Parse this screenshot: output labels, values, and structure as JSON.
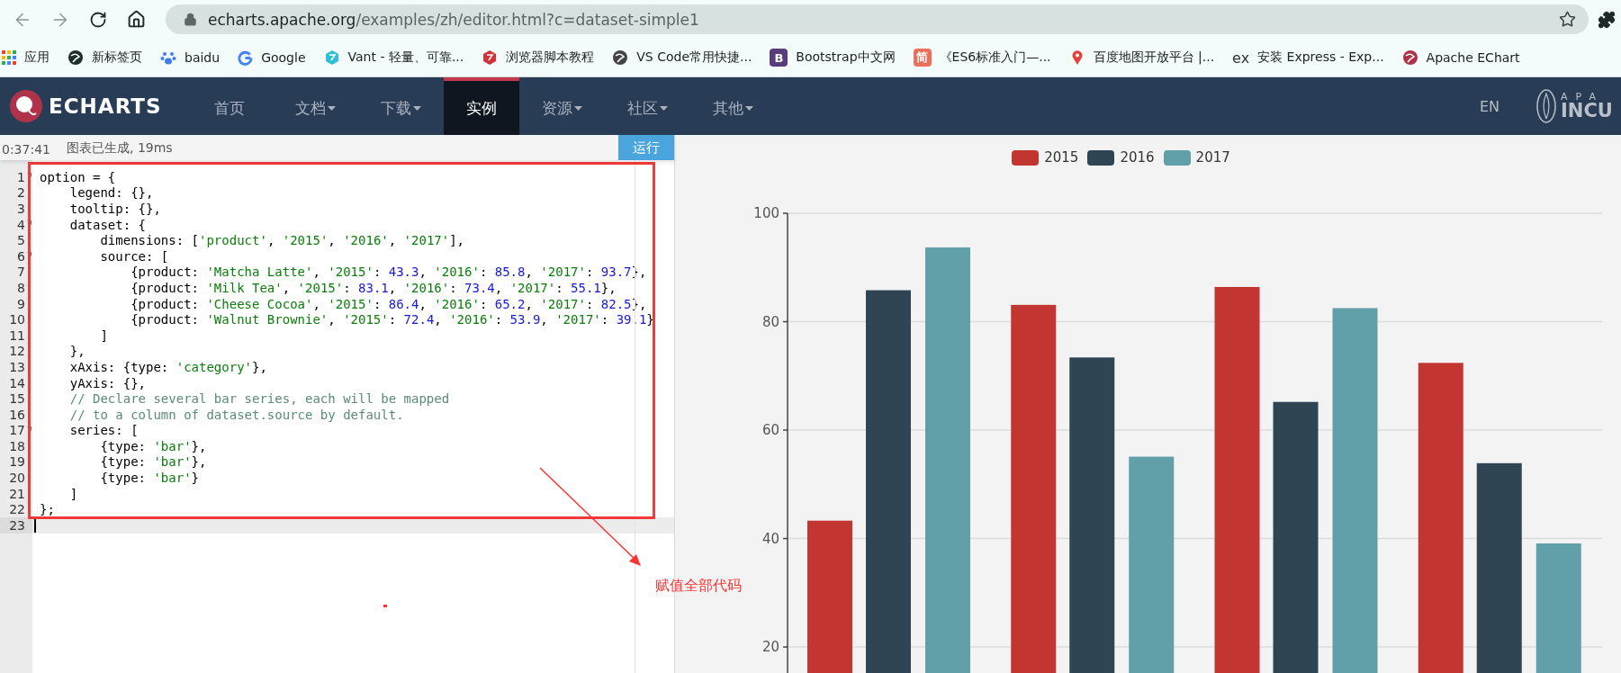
{
  "browser": {
    "address": {
      "host": "echarts.apache.org",
      "path": "/examples/zh/editor.html?c=dataset-simple1"
    },
    "bookmarks": [
      {
        "label": "应用",
        "kind": "apps"
      },
      {
        "label": "新标签页",
        "kind": "globe",
        "color": "#1f2d2d"
      },
      {
        "label": "baidu",
        "kind": "paw",
        "color": "#3b7cf0"
      },
      {
        "label": "Google",
        "kind": "google",
        "color": "#4285f4"
      },
      {
        "label": "Vant - 轻量、可靠...",
        "kind": "hex",
        "color": "#2fc0d4"
      },
      {
        "label": "浏览器脚本教程",
        "kind": "hex",
        "color": "#d4303a"
      },
      {
        "label": "VS Code常用快捷...",
        "kind": "globe",
        "color": "#444444"
      },
      {
        "label": "Bootstrap中文网",
        "kind": "glyph",
        "glyph": "B",
        "color": "#563d7c"
      },
      {
        "label": "《ES6标准入门—...",
        "kind": "glyph",
        "glyph": "简",
        "color": "#ea6f5a"
      },
      {
        "label": "百度地图开放平台 |...",
        "kind": "pin",
        "color": "#e8413b"
      },
      {
        "label": "安装 Express - Exp...",
        "kind": "text",
        "glyph": "ex",
        "color": "#333333"
      },
      {
        "label": "Apache EChart",
        "kind": "globe",
        "color": "#b0324a"
      }
    ]
  },
  "navbar": {
    "logo": "ECHARTS",
    "items": [
      {
        "label": "首页",
        "dropdown": false,
        "selected": false
      },
      {
        "label": "文档",
        "dropdown": true,
        "selected": false
      },
      {
        "label": "下载",
        "dropdown": true,
        "selected": false
      },
      {
        "label": "实例",
        "dropdown": false,
        "selected": true
      },
      {
        "label": "资源",
        "dropdown": true,
        "selected": false
      },
      {
        "label": "社区",
        "dropdown": true,
        "selected": false
      },
      {
        "label": "其他",
        "dropdown": true,
        "selected": false
      }
    ],
    "language": "EN",
    "incubator": {
      "top": "APA",
      "bottom": "INCU"
    }
  },
  "editor": {
    "time": "0:37:41",
    "status": "图表已生成, 19ms",
    "run_button": "运行",
    "lines": [
      {
        "number": "1",
        "fold": true,
        "current": false,
        "tokens": [
          {
            "kind": "plain",
            "text": "option = {"
          }
        ]
      },
      {
        "number": "2",
        "fold": false,
        "current": false,
        "tokens": [
          {
            "kind": "plain",
            "text": "    legend: {},"
          }
        ]
      },
      {
        "number": "3",
        "fold": false,
        "current": false,
        "tokens": [
          {
            "kind": "plain",
            "text": "    tooltip: {},"
          }
        ]
      },
      {
        "number": "4",
        "fold": true,
        "current": false,
        "tokens": [
          {
            "kind": "plain",
            "text": "    dataset: {"
          }
        ]
      },
      {
        "number": "5",
        "fold": false,
        "current": false,
        "tokens": [
          {
            "kind": "plain",
            "text": "        dimensions: ["
          },
          {
            "kind": "string",
            "text": "'product'"
          },
          {
            "kind": "plain",
            "text": ", "
          },
          {
            "kind": "string",
            "text": "'2015'"
          },
          {
            "kind": "plain",
            "text": ", "
          },
          {
            "kind": "string",
            "text": "'2016'"
          },
          {
            "kind": "plain",
            "text": ", "
          },
          {
            "kind": "string",
            "text": "'2017'"
          },
          {
            "kind": "plain",
            "text": "],"
          }
        ]
      },
      {
        "number": "6",
        "fold": true,
        "current": false,
        "tokens": [
          {
            "kind": "plain",
            "text": "        source: ["
          }
        ]
      },
      {
        "number": "7",
        "fold": false,
        "current": false,
        "tokens": [
          {
            "kind": "plain",
            "text": "            {product: "
          },
          {
            "kind": "string",
            "text": "'Matcha Latte'"
          },
          {
            "kind": "plain",
            "text": ", "
          },
          {
            "kind": "string",
            "text": "'2015'"
          },
          {
            "kind": "plain",
            "text": ": "
          },
          {
            "kind": "number",
            "text": "43.3"
          },
          {
            "kind": "plain",
            "text": ", "
          },
          {
            "kind": "string",
            "text": "'2016'"
          },
          {
            "kind": "plain",
            "text": ": "
          },
          {
            "kind": "number",
            "text": "85.8"
          },
          {
            "kind": "plain",
            "text": ", "
          },
          {
            "kind": "string",
            "text": "'2017'"
          },
          {
            "kind": "plain",
            "text": ": "
          },
          {
            "kind": "number",
            "text": "93.7"
          },
          {
            "kind": "plain",
            "text": "},"
          }
        ]
      },
      {
        "number": "8",
        "fold": false,
        "current": false,
        "tokens": [
          {
            "kind": "plain",
            "text": "            {product: "
          },
          {
            "kind": "string",
            "text": "'Milk Tea'"
          },
          {
            "kind": "plain",
            "text": ", "
          },
          {
            "kind": "string",
            "text": "'2015'"
          },
          {
            "kind": "plain",
            "text": ": "
          },
          {
            "kind": "number",
            "text": "83.1"
          },
          {
            "kind": "plain",
            "text": ", "
          },
          {
            "kind": "string",
            "text": "'2016'"
          },
          {
            "kind": "plain",
            "text": ": "
          },
          {
            "kind": "number",
            "text": "73.4"
          },
          {
            "kind": "plain",
            "text": ", "
          },
          {
            "kind": "string",
            "text": "'2017'"
          },
          {
            "kind": "plain",
            "text": ": "
          },
          {
            "kind": "number",
            "text": "55.1"
          },
          {
            "kind": "plain",
            "text": "},"
          }
        ]
      },
      {
        "number": "9",
        "fold": false,
        "current": false,
        "tokens": [
          {
            "kind": "plain",
            "text": "            {product: "
          },
          {
            "kind": "string",
            "text": "'Cheese Cocoa'"
          },
          {
            "kind": "plain",
            "text": ", "
          },
          {
            "kind": "string",
            "text": "'2015'"
          },
          {
            "kind": "plain",
            "text": ": "
          },
          {
            "kind": "number",
            "text": "86.4"
          },
          {
            "kind": "plain",
            "text": ", "
          },
          {
            "kind": "string",
            "text": "'2016'"
          },
          {
            "kind": "plain",
            "text": ": "
          },
          {
            "kind": "number",
            "text": "65.2"
          },
          {
            "kind": "plain",
            "text": ", "
          },
          {
            "kind": "string",
            "text": "'2017'"
          },
          {
            "kind": "plain",
            "text": ": "
          },
          {
            "kind": "number",
            "text": "82.5"
          },
          {
            "kind": "plain",
            "text": "},"
          }
        ]
      },
      {
        "number": "10",
        "fold": false,
        "current": false,
        "tokens": [
          {
            "kind": "plain",
            "text": "            {product: "
          },
          {
            "kind": "string",
            "text": "'Walnut Brownie'"
          },
          {
            "kind": "plain",
            "text": ", "
          },
          {
            "kind": "string",
            "text": "'2015'"
          },
          {
            "kind": "plain",
            "text": ": "
          },
          {
            "kind": "number",
            "text": "72.4"
          },
          {
            "kind": "plain",
            "text": ", "
          },
          {
            "kind": "string",
            "text": "'2016'"
          },
          {
            "kind": "plain",
            "text": ": "
          },
          {
            "kind": "number",
            "text": "53.9"
          },
          {
            "kind": "plain",
            "text": ", "
          },
          {
            "kind": "string",
            "text": "'2017'"
          },
          {
            "kind": "plain",
            "text": ": "
          },
          {
            "kind": "number",
            "text": "39.1"
          },
          {
            "kind": "plain",
            "text": "}"
          }
        ]
      },
      {
        "number": "11",
        "fold": false,
        "current": false,
        "tokens": [
          {
            "kind": "plain",
            "text": "        ]"
          }
        ]
      },
      {
        "number": "12",
        "fold": false,
        "current": false,
        "tokens": [
          {
            "kind": "plain",
            "text": "    },"
          }
        ]
      },
      {
        "number": "13",
        "fold": false,
        "current": false,
        "tokens": [
          {
            "kind": "plain",
            "text": "    xAxis: {type: "
          },
          {
            "kind": "string",
            "text": "'category'"
          },
          {
            "kind": "plain",
            "text": "},"
          }
        ]
      },
      {
        "number": "14",
        "fold": false,
        "current": false,
        "tokens": [
          {
            "kind": "plain",
            "text": "    yAxis: {},"
          }
        ]
      },
      {
        "number": "15",
        "fold": false,
        "current": false,
        "tokens": [
          {
            "kind": "comment",
            "text": "    // Declare several bar series, each will be mapped"
          }
        ]
      },
      {
        "number": "16",
        "fold": false,
        "current": false,
        "tokens": [
          {
            "kind": "comment",
            "text": "    // to a column of dataset.source by default."
          }
        ]
      },
      {
        "number": "17",
        "fold": true,
        "current": false,
        "tokens": [
          {
            "kind": "plain",
            "text": "    series: ["
          }
        ]
      },
      {
        "number": "18",
        "fold": false,
        "current": false,
        "tokens": [
          {
            "kind": "plain",
            "text": "        {type: "
          },
          {
            "kind": "string",
            "text": "'bar'"
          },
          {
            "kind": "plain",
            "text": "},"
          }
        ]
      },
      {
        "number": "19",
        "fold": false,
        "current": false,
        "tokens": [
          {
            "kind": "plain",
            "text": "        {type: "
          },
          {
            "kind": "string",
            "text": "'bar'"
          },
          {
            "kind": "plain",
            "text": "},"
          }
        ]
      },
      {
        "number": "20",
        "fold": false,
        "current": false,
        "tokens": [
          {
            "kind": "plain",
            "text": "        {type: "
          },
          {
            "kind": "string",
            "text": "'bar'"
          },
          {
            "kind": "plain",
            "text": "}"
          }
        ]
      },
      {
        "number": "21",
        "fold": false,
        "current": false,
        "tokens": [
          {
            "kind": "plain",
            "text": "    ]"
          }
        ]
      },
      {
        "number": "22",
        "fold": false,
        "current": false,
        "tokens": [
          {
            "kind": "plain",
            "text": "};"
          }
        ]
      },
      {
        "number": "23",
        "fold": false,
        "current": true
      }
    ]
  },
  "annotation": {
    "label": "赋值全部代码"
  },
  "chart": {
    "chart_data": {
      "type": "bar",
      "legend": true,
      "grid": true,
      "ylim": [
        15.2,
        100
      ],
      "yticks": [
        20,
        40,
        60,
        80,
        100
      ],
      "series": [
        {
          "name": "2015",
          "color": "#c23531",
          "values": [
            43.3,
            83.1,
            86.4,
            72.4
          ]
        },
        {
          "name": "2016",
          "color": "#2f4554",
          "values": [
            85.8,
            73.4,
            65.2,
            53.9
          ]
        },
        {
          "name": "2017",
          "color": "#61a0a8",
          "values": [
            93.7,
            55.1,
            82.5,
            39.1
          ]
        }
      ]
    }
  }
}
